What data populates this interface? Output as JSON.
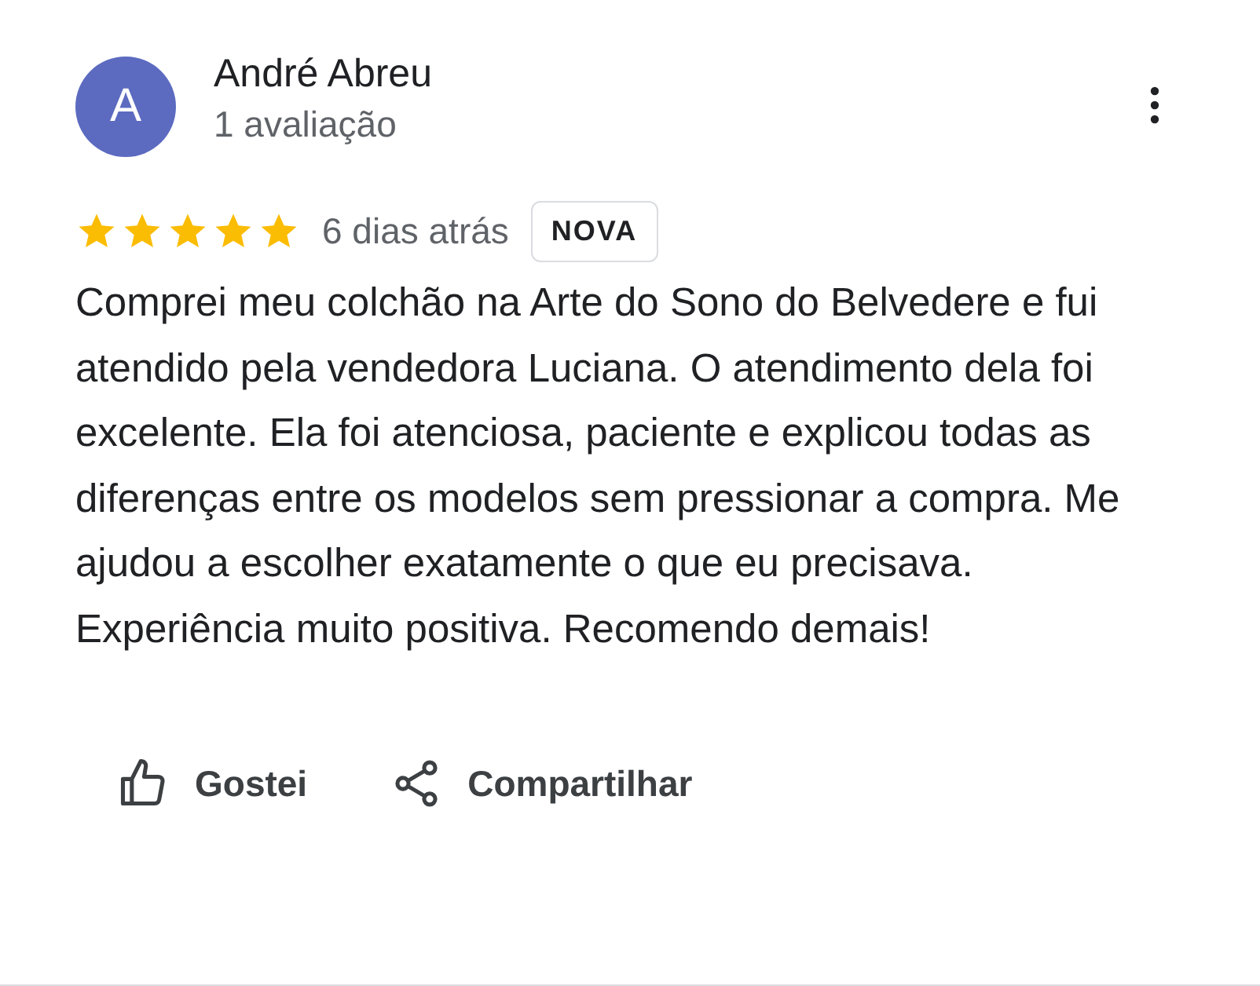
{
  "review": {
    "avatar_letter": "A",
    "author": "André Abreu",
    "author_meta": "1 avaliação",
    "stars": 5,
    "date": "6 dias atrás",
    "badge": "NOVA",
    "text": "Comprei meu colchão na Arte do Sono do Belvedere e fui atendido pela vendedora Luciana. O atendimento dela foi excelente. Ela foi atenciosa, paciente e explicou todas as diferenças entre os modelos sem pressionar a compra. Me ajudou a escolher exatamente o que eu precisava. Experiência muito positiva. Recomendo demais!"
  },
  "actions": [
    {
      "kind": "like",
      "label": "Gostei"
    },
    {
      "kind": "share",
      "label": "Compartilhar"
    }
  ]
}
